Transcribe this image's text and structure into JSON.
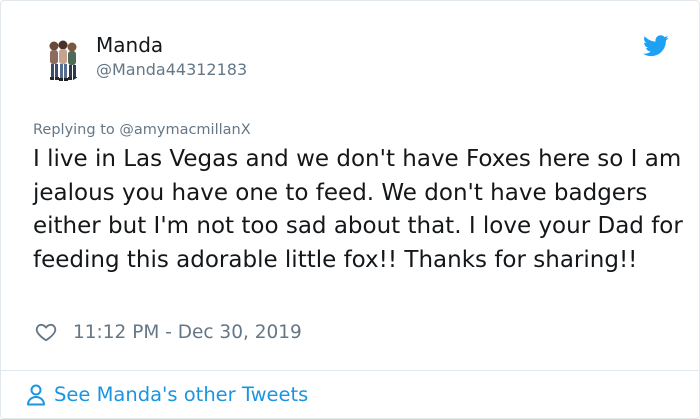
{
  "author": {
    "name": "Manda",
    "handle": "@Manda44312183"
  },
  "reply": {
    "prefix": "Replying to ",
    "mention": "@amymacmillanX"
  },
  "tweet": {
    "text": "I live in Las Vegas and we don't have Foxes here so I am jealous you have one to feed.  We don't have badgers either but I'm not too sad about that.  I love your Dad for feeding this adorable little fox!! Thanks for sharing!!",
    "timestamp": "11:12 PM - Dec 30, 2019"
  },
  "footer": {
    "label": "See Manda's other Tweets"
  },
  "icons": {
    "logo": "twitter-bird-icon",
    "like": "heart-icon",
    "profile": "person-icon"
  },
  "colors": {
    "brand": "#1da1f2",
    "link": "#1b95e0",
    "secondary_text": "#657786",
    "primary_text": "#14171a",
    "border": "#e1e8ed"
  }
}
